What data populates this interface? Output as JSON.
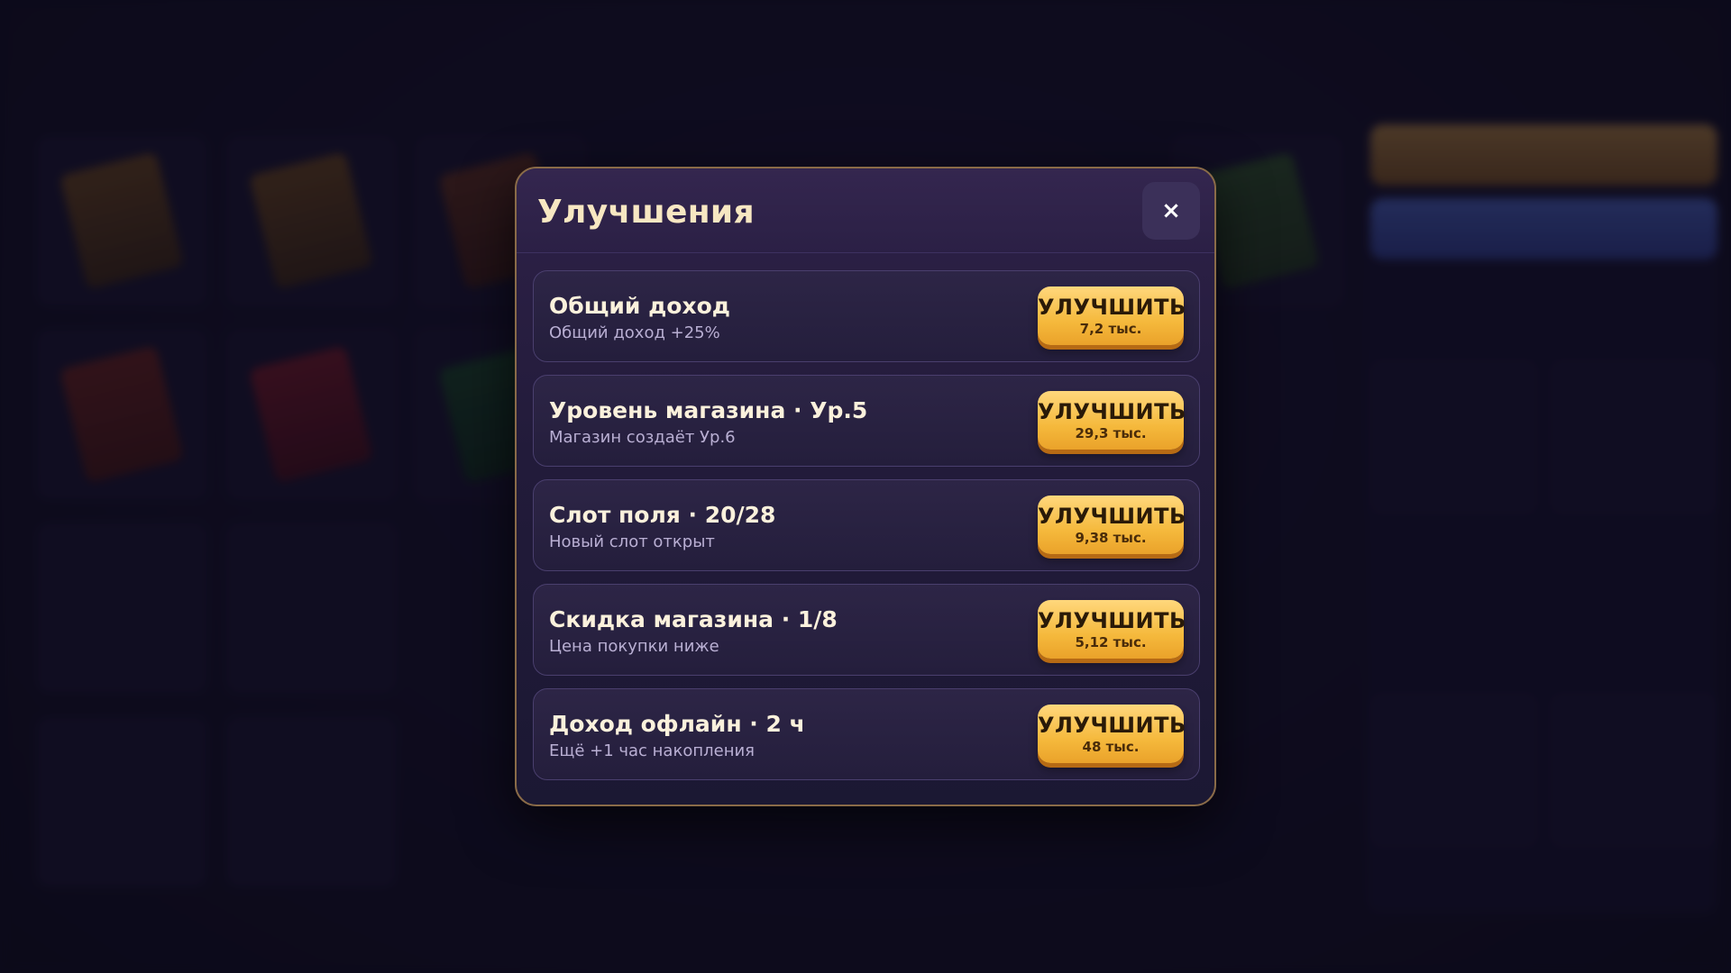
{
  "modal": {
    "title": "Улучшения",
    "close_label": "×",
    "upgrades": [
      {
        "title": "Общий доход",
        "subtitle": "Общий доход +25%",
        "button_label": "УЛУЧШИТЬ",
        "cost": "7,2 тыс."
      },
      {
        "title": "Уровень магазина · Ур.5",
        "subtitle": "Магазин создаёт Ур.6",
        "button_label": "УЛУЧШИТЬ",
        "cost": "29,3 тыс."
      },
      {
        "title": "Слот поля · 20/28",
        "subtitle": "Новый слот открыт",
        "button_label": "УЛУЧШИТЬ",
        "cost": "9,38 тыс."
      },
      {
        "title": "Скидка магазина · 1/8",
        "subtitle": "Цена покупки ниже",
        "button_label": "УЛУЧШИТЬ",
        "cost": "5,12 тыс."
      },
      {
        "title": "Доход офлайн · 2 ч",
        "subtitle": "Ещё +1 час накопления",
        "button_label": "УЛУЧШИТЬ",
        "cost": "48 тыс."
      }
    ]
  },
  "colors": {
    "modal_border": "#8a6b48",
    "title": "#f7e7c2",
    "button_gold": "#f5b93c",
    "button_shadow": "#b66a14"
  }
}
